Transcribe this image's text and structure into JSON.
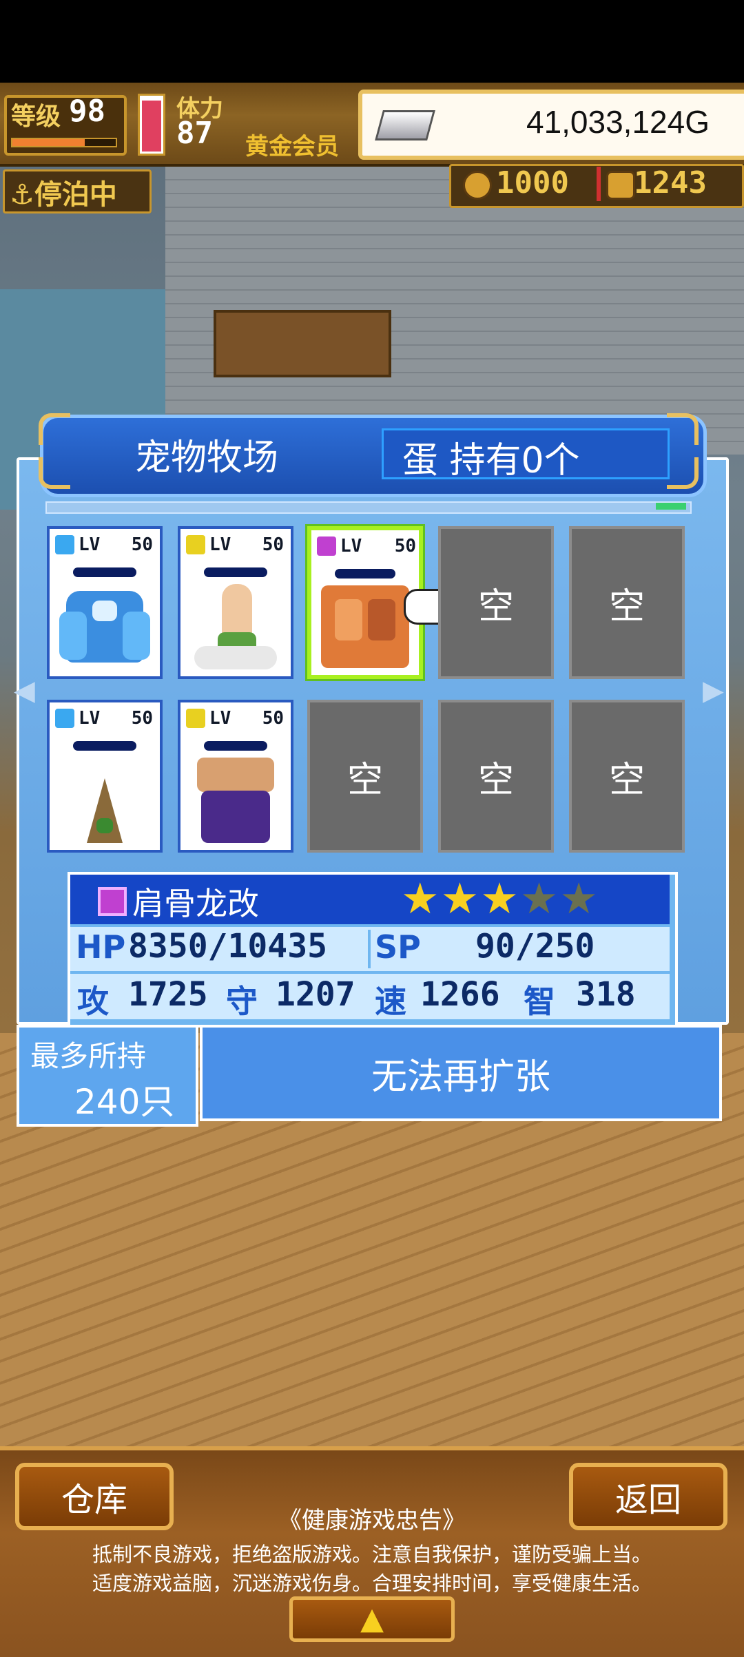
{
  "hud": {
    "level_label": "等级",
    "level_value": "98",
    "level_progress": 0.7,
    "stamina_label": "体力",
    "stamina_value": "87",
    "stamina_level": 0.95,
    "member_label": "黄金会员",
    "gold_value": "41,033,124G",
    "dock_label": "停泊中",
    "resource1": "1000",
    "resource2": "1243"
  },
  "ranch": {
    "title": "宠物牧场",
    "egg_text": "蛋 持有0个",
    "slots": [
      {
        "lv_label": "LV",
        "level": "50",
        "element": "water",
        "element_color": "#3aa8f0",
        "state": "filled",
        "creature": "blue-golem"
      },
      {
        "lv_label": "LV",
        "level": "50",
        "element": "thunder",
        "element_color": "#e8d020",
        "state": "filled",
        "creature": "cloud-sage"
      },
      {
        "lv_label": "LV",
        "level": "50",
        "element": "dark",
        "element_color": "#c040d0",
        "state": "selected",
        "creature": "bone-dragon"
      },
      {
        "state": "empty",
        "label": "空"
      },
      {
        "state": "empty",
        "label": "空"
      },
      {
        "lv_label": "LV",
        "level": "50",
        "element": "water",
        "element_color": "#3aa8f0",
        "state": "filled",
        "creature": "shell-mole"
      },
      {
        "lv_label": "LV",
        "level": "50",
        "element": "thunder",
        "element_color": "#e8d020",
        "state": "filled",
        "creature": "purple-brute"
      },
      {
        "state": "empty",
        "label": "空"
      },
      {
        "state": "empty",
        "label": "空"
      },
      {
        "state": "empty",
        "label": "空"
      }
    ]
  },
  "info": {
    "name": "肩骨龙改",
    "stars_filled": 3,
    "stars_total": 5,
    "hp_label": "HP",
    "hp_value": "8350/10435",
    "sp_label": "SP",
    "sp_value": "90/250",
    "atk_label": "攻",
    "atk_value": "1725",
    "def_label": "守",
    "def_value": "1207",
    "spd_label": "速",
    "spd_value": "1266",
    "int_label": "智",
    "int_value": "318"
  },
  "capacity": {
    "label": "最多所持",
    "value": "240只",
    "expand_button": "无法再扩张"
  },
  "bottom": {
    "warehouse_button": "仓库",
    "back_button": "返回",
    "warning_title": "《健康游戏忠告》",
    "warning_line1": "抵制不良游戏，拒绝盗版游戏。注意自我保护，谨防受骗上当。",
    "warning_line2": "适度游戏益脑，沉迷游戏伤身。合理安排时间，享受健康生活。"
  },
  "colors": {
    "accent_blue": "#1c4fb0",
    "star_gold": "#f8d020",
    "star_empty": "#6a7050",
    "select_green": "#a8f020"
  }
}
